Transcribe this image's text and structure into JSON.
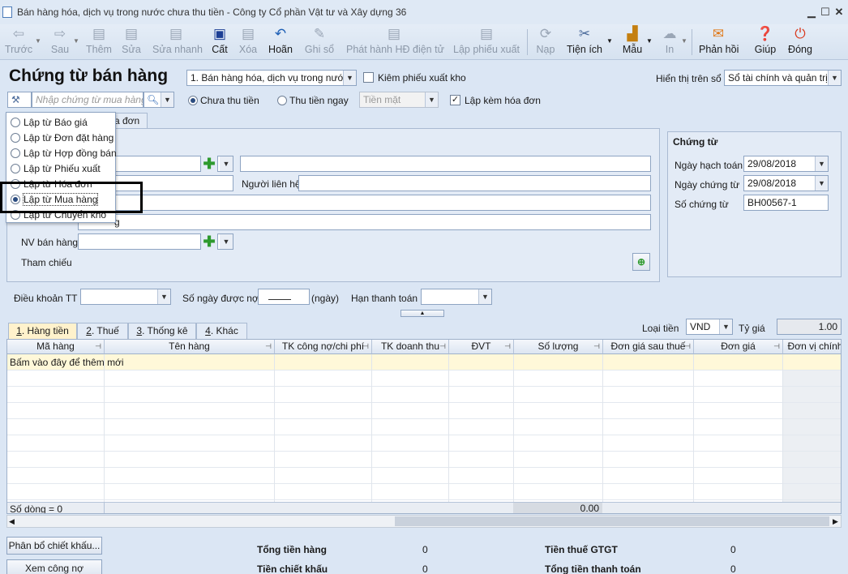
{
  "window": {
    "title": "Bán hàng hóa, dịch vụ trong nước chưa thu tiền - Công ty Cổ phần Vật tư và Xây dựng 36"
  },
  "toolbar": {
    "back": "Trước",
    "next": "Sau",
    "add": "Thêm",
    "edit": "Sửa",
    "quick_edit": "Sửa nhanh",
    "save": "Cất",
    "delete": "Xóa",
    "undo": "Hoãn",
    "post": "Ghi sổ",
    "issue_einvoice": "Phát hành HĐ điện tử",
    "create_delivery": "Lập phiếu xuất",
    "load": "Nạp",
    "utilities": "Tiện ích",
    "template": "Mẫu",
    "print": "In",
    "feedback": "Phản hồi",
    "help": "Giúp",
    "close": "Đóng"
  },
  "header": {
    "title": "Chứng từ bán hàng",
    "sale_type": "1. Bán hàng hóa, dịch vụ trong nước",
    "check_delivery": "Kiêm phiếu xuất kho",
    "show_on_label": "Hiển thị trên sổ",
    "show_on_value": "Sổ tài chính và quản trị",
    "search_placeholder": "Nhập chứng từ mua hàng",
    "unpaid": "Chưa thu tiền",
    "paid_now": "Thu tiền ngay",
    "cash": "Tiền mặt",
    "with_invoice": "Lập kèm hóa đơn"
  },
  "menu": {
    "items": [
      {
        "label": "Lập từ Báo giá",
        "selected": false
      },
      {
        "label": "Lập từ Đơn đặt hàng",
        "selected": false
      },
      {
        "label": "Lập từ Hợp đồng bán",
        "selected": false
      },
      {
        "label": "Lập từ Phiếu xuất",
        "selected": false
      },
      {
        "label": "Lập từ Hóa đơn",
        "selected": false
      },
      {
        "label": "Lập từ Mua hàng",
        "selected": true
      },
      {
        "label": "Lập từ Chuyển kho",
        "selected": false
      }
    ]
  },
  "subtab": {
    "invoice_tab": "a đơn"
  },
  "customer": {
    "contact_label": "Người liên hệ",
    "partial_text": "g",
    "salesperson_label": "NV bán hàng",
    "reference_label": "Tham chiếu"
  },
  "voucher": {
    "group_title": "Chứng từ",
    "posting_date_label": "Ngày hạch toán",
    "posting_date": "29/08/2018",
    "voucher_date_label": "Ngày chứng từ",
    "voucher_date": "29/08/2018",
    "voucher_no_label": "Số chứng từ",
    "voucher_no": "BH00567-1"
  },
  "terms": {
    "payment_terms_label": "Điều khoản TT",
    "credit_days_label": "Số ngày được nợ",
    "credit_days_unit": "(ngày)",
    "due_date_label": "Hạn thanh toán"
  },
  "tabs": [
    {
      "num": "1",
      "label": ". Hàng tiền"
    },
    {
      "num": "2",
      "label": ". Thuế"
    },
    {
      "num": "3",
      "label": ". Thống kê"
    },
    {
      "num": "4",
      "label": ". Khác"
    }
  ],
  "currency": {
    "label": "Loại tiền",
    "value": "VND",
    "rate_label": "Tỷ giá",
    "rate": "1.00"
  },
  "grid": {
    "columns": [
      "Mã hàng",
      "Tên hàng",
      "TK công nợ/chi phí",
      "TK doanh thu",
      "ĐVT",
      "Số lượng",
      "Đơn giá sau thuế",
      "Đơn giá",
      "Đơn vị chính"
    ],
    "add_row_hint": "Bấm vào đây để thêm mới",
    "row_count": "Số dòng = 0",
    "qty_total": "0.00"
  },
  "bottom": {
    "discount_alloc": "Phân bổ chiết khấu...",
    "view_debt": "Xem công nợ",
    "total_goods_label": "Tổng tiền hàng",
    "total_goods": "0",
    "discount_label": "Tiền chiết khấu",
    "discount": "0",
    "vat_label": "Tiền thuế GTGT",
    "vat": "0",
    "grand_total_label": "Tổng tiền thanh toán",
    "grand_total": "0"
  }
}
